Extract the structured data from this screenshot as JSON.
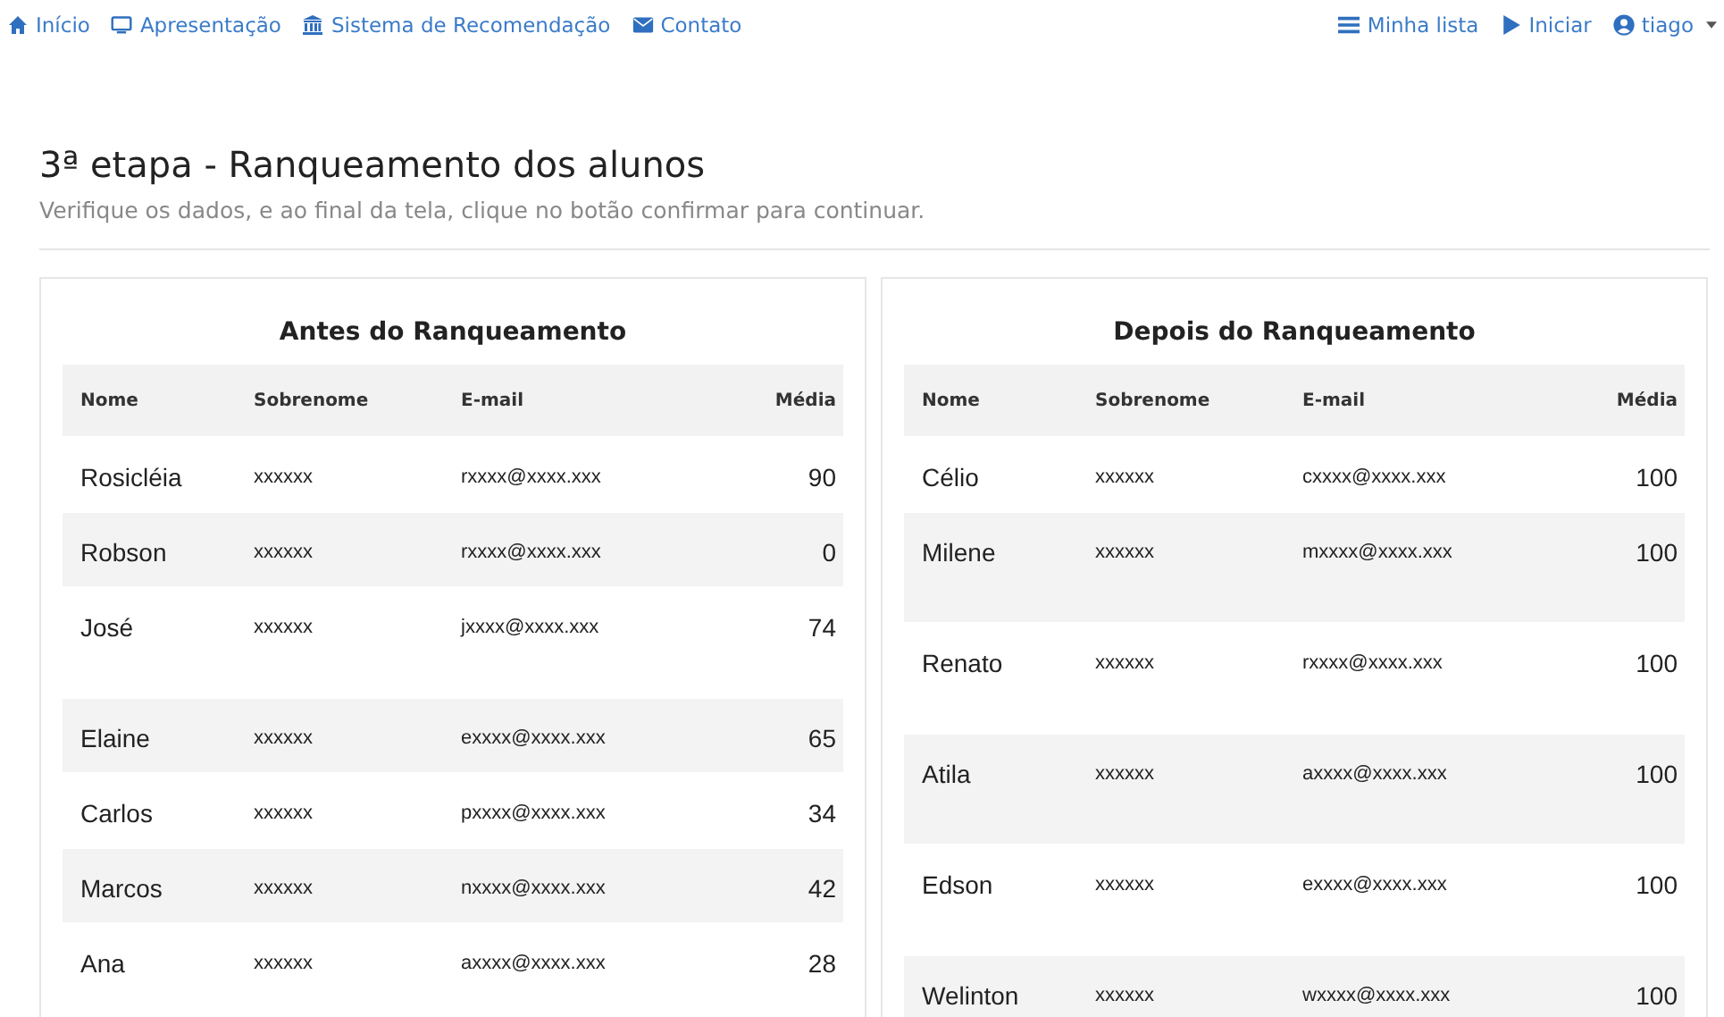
{
  "navbar": {
    "left": [
      {
        "label": "Início"
      },
      {
        "label": "Apresentação"
      },
      {
        "label": "Sistema de Recomendação"
      },
      {
        "label": "Contato"
      }
    ],
    "right": [
      {
        "label": "Minha lista"
      },
      {
        "label": "Iniciar"
      },
      {
        "label": "tiago"
      }
    ]
  },
  "heading": {
    "title": "3ª etapa - Ranqueamento dos alunos",
    "subtitle": "Verifique os dados, e ao final da tela, clique no botão confirmar para continuar."
  },
  "tables": [
    {
      "title": "Antes do Ranqueamento",
      "columns": [
        "Nome",
        "Sobrenome",
        "E-mail",
        "Média"
      ],
      "rows": [
        [
          "Rosicléia",
          "xxxxxx",
          "rxxxx@xxxx.xxx",
          "90"
        ],
        [
          "Robson",
          "xxxxxx",
          "rxxxx@xxxx.xxx",
          "0"
        ],
        [
          "José",
          "xxxxxx",
          "jxxxx@xxxx.xxx",
          "74"
        ],
        [
          "Elaine",
          "xxxxxx",
          "exxxx@xxxx.xxx",
          "65"
        ],
        [
          "Carlos",
          "xxxxxx",
          "pxxxx@xxxx.xxx",
          "34"
        ],
        [
          "Marcos",
          "xxxxxx",
          "nxxxx@xxxx.xxx",
          "42"
        ],
        [
          "Ana",
          "xxxxxx",
          "axxxx@xxxx.xxx",
          "28"
        ]
      ]
    },
    {
      "title": "Depois do Ranqueamento",
      "columns": [
        "Nome",
        "Sobrenome",
        "E-mail",
        "Média"
      ],
      "rows": [
        [
          "Célio",
          "xxxxxx",
          "cxxxx@xxxx.xxx",
          "100"
        ],
        [
          "Milene",
          "xxxxxx",
          "mxxxx@xxxx.xxx",
          "100"
        ],
        [
          "Renato",
          "xxxxxx",
          "rxxxx@xxxx.xxx",
          "100"
        ],
        [
          "Atila",
          "xxxxxx",
          "axxxx@xxxx.xxx",
          "100"
        ],
        [
          "Edson",
          "xxxxxx",
          "exxxx@xxxx.xxx",
          "100"
        ],
        [
          "Welinton",
          "xxxxxx",
          "wxxxx@xxxx.xxx",
          "100"
        ]
      ]
    }
  ]
}
